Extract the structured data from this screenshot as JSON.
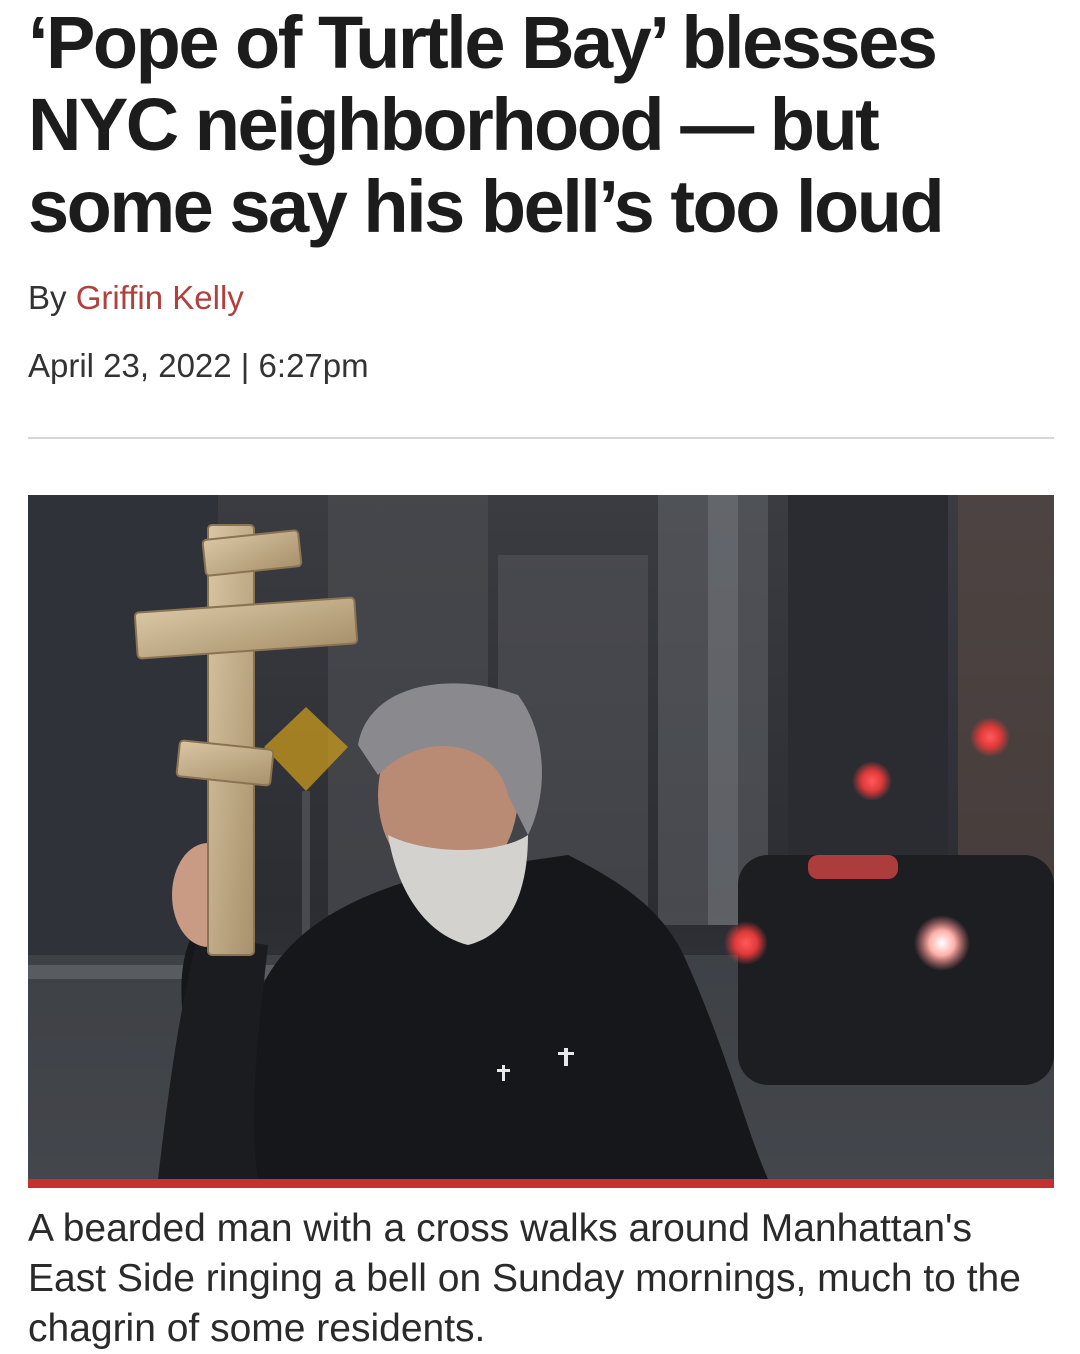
{
  "article": {
    "headline": "‘Pope of Turtle Bay’ blesses NYC neighborhood — but some say his bell’s too loud",
    "byline_prefix": "By ",
    "author": "Griffin Kelly",
    "dateline": "April 23, 2022 | 6:27pm",
    "caption": "A bearded man with a cross walks around Manhattan's East Side ringing a bell on Sunday mornings, much to the chagrin of some residents.",
    "accent_color": "#c8312b",
    "author_color": "#b0413e"
  }
}
